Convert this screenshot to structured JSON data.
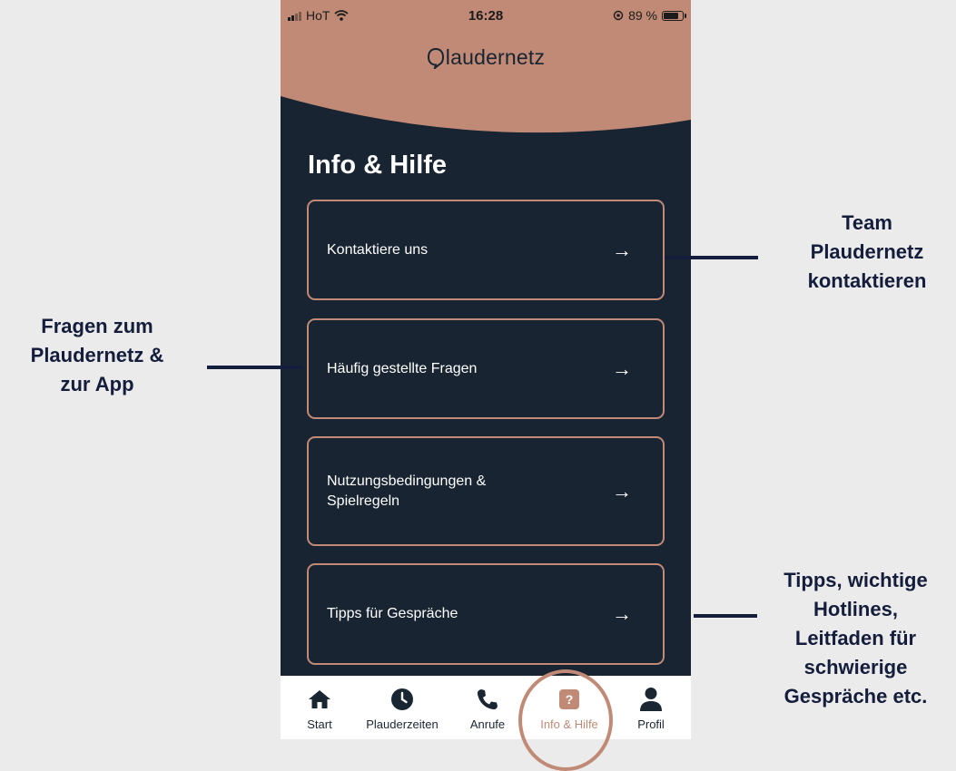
{
  "status": {
    "carrier": "HoT",
    "time": "16:28",
    "battery": "89 %",
    "battery_level": 0.89
  },
  "app": {
    "logo_text": "laudernetz",
    "title": "Info & Hilfe"
  },
  "menu": [
    {
      "label": "Kontaktiere uns",
      "arrow": "→"
    },
    {
      "label": "Häufig gestellte Fragen",
      "arrow": "→"
    },
    {
      "label": "Nutzungsbedingungen &\nSpielregeln",
      "arrow": "→"
    },
    {
      "label": "Tipps für Gespräche",
      "arrow": "→"
    }
  ],
  "tabs": [
    {
      "label": "Start",
      "icon": "home-icon"
    },
    {
      "label": "Plauderzeiten",
      "icon": "clock-icon"
    },
    {
      "label": "Anrufe",
      "icon": "phone-icon"
    },
    {
      "label": "Info & Hilfe",
      "icon": "help-icon",
      "active": true
    },
    {
      "label": "Profil",
      "icon": "user-icon"
    }
  ],
  "annotations": {
    "contact": "Team\nPlaudernetz\nkontaktieren",
    "faq": "Fragen zum\nPlaudernetz &\nzur App",
    "tips": "Tipps, wichtige\nHotlines,\nLeitfaden für\nschwierige\nGespräche etc."
  },
  "colors": {
    "accent": "#c08a76",
    "dark": "#182431",
    "annotation": "#141d3b",
    "background": "#ebebeb"
  }
}
